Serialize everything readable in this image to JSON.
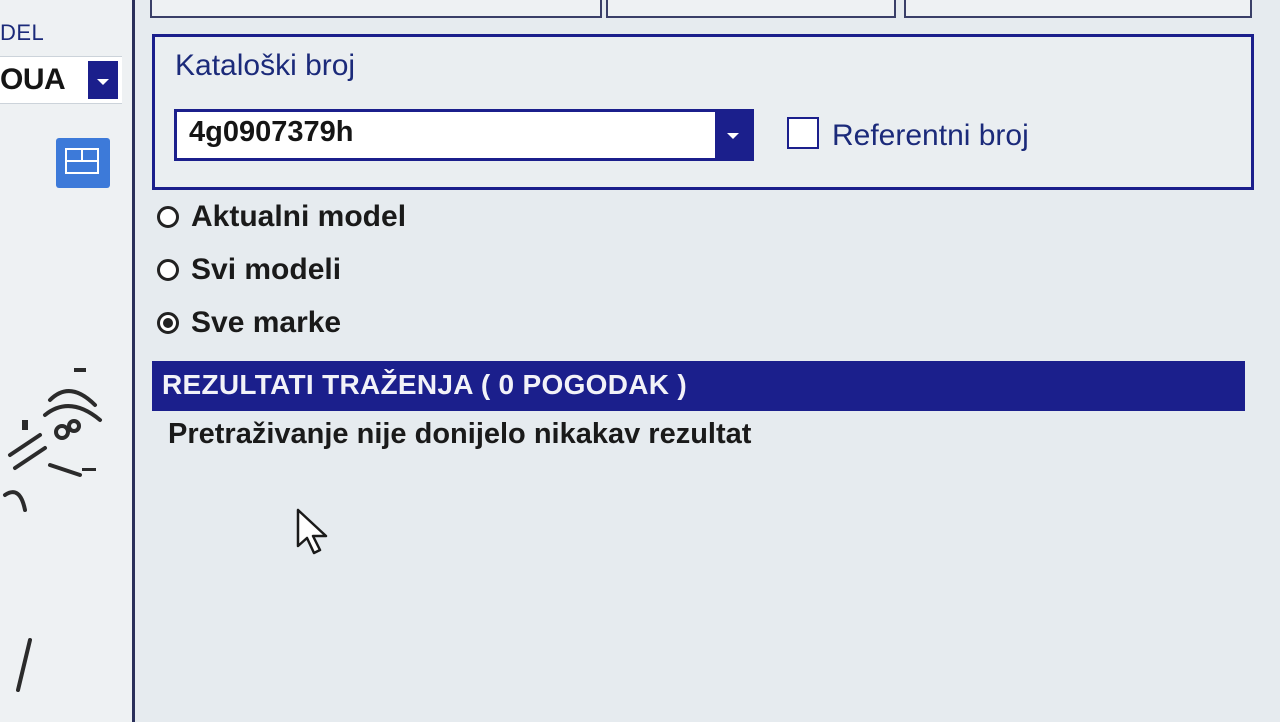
{
  "left_panel": {
    "model_label": "DEL",
    "model_value": "OUA"
  },
  "search": {
    "label": "Kataloški broj",
    "part_number": "4g0907379h",
    "reference_checkbox_label": "Referentni broj",
    "reference_checked": false
  },
  "scope_options": [
    {
      "label": "Aktualni model",
      "selected": false
    },
    {
      "label": "Svi modeli",
      "selected": false
    },
    {
      "label": "Sve marke",
      "selected": true
    }
  ],
  "results": {
    "title": "REZULTATI TRAŽENJA  ( 0 POGODAK )",
    "message": "Pretraživanje nije donijelo nikakav rezultat"
  },
  "colors": {
    "accent": "#1b1f8c",
    "label_text": "#1b2a7a",
    "view_button": "#3d7ad9"
  }
}
